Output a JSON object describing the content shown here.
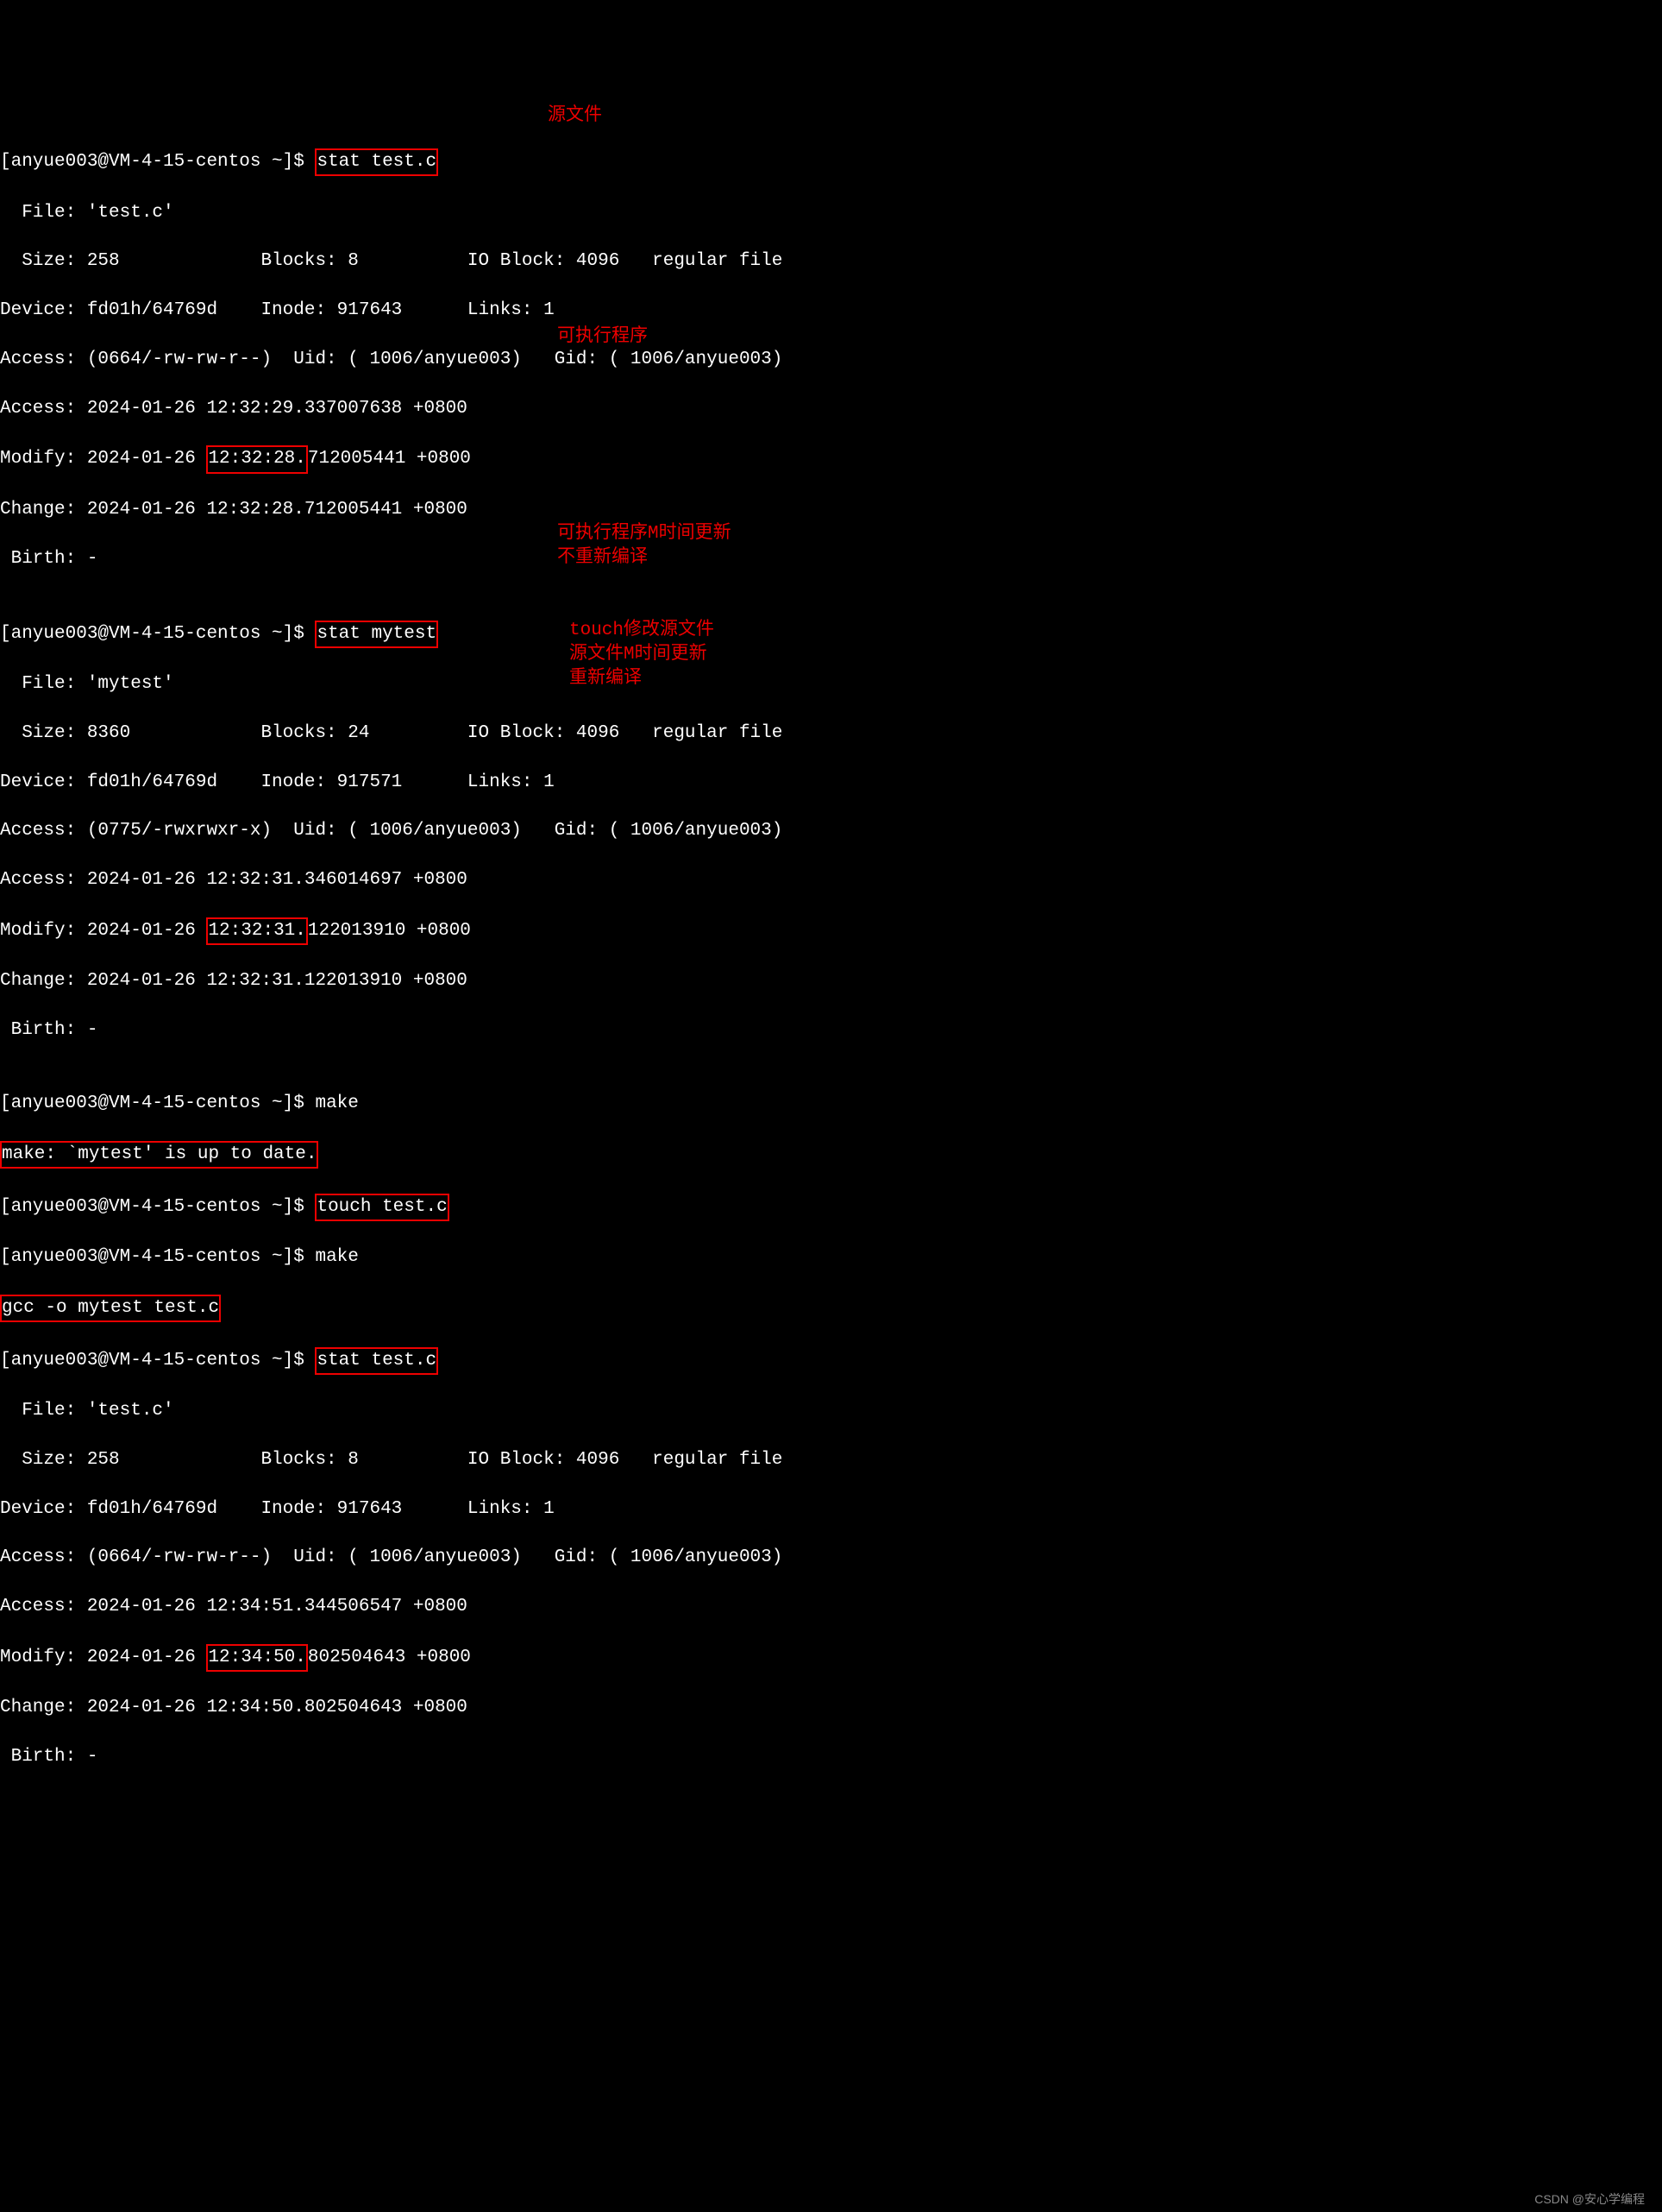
{
  "prompt": "[anyue003@VM-4-15-centos ~]$ ",
  "cmd1": "stat test.c",
  "stat1": {
    "file": "  File: 'test.c'",
    "size": "  Size: 258             Blocks: 8          IO Block: 4096   regular file",
    "device": "Device: fd01h/64769d    Inode: 917643      Links: 1",
    "access_perm": "Access: (0664/-rw-rw-r--)  Uid: ( 1006/anyue003)   Gid: ( 1006/anyue003)",
    "atime": "Access: 2024-01-26 12:32:29.337007638 +0800",
    "mtime_pre": "Modify: 2024-01-26 ",
    "mtime_box": "12:32:28.",
    "mtime_post": "712005441 +0800",
    "ctime": "Change: 2024-01-26 12:32:28.712005441 +0800",
    "birth": " Birth: -"
  },
  "cmd2": "stat mytest",
  "stat2": {
    "file": "  File: 'mytest'",
    "size": "  Size: 8360            Blocks: 24         IO Block: 4096   regular file",
    "device": "Device: fd01h/64769d    Inode: 917571      Links: 1",
    "access_perm": "Access: (0775/-rwxrwxr-x)  Uid: ( 1006/anyue003)   Gid: ( 1006/anyue003)",
    "atime": "Access: 2024-01-26 12:32:31.346014697 +0800",
    "mtime_pre": "Modify: 2024-01-26 ",
    "mtime_box": "12:32:31.",
    "mtime_post": "122013910 +0800",
    "ctime": "Change: 2024-01-26 12:32:31.122013910 +0800",
    "birth": " Birth: -"
  },
  "cmd3": "make",
  "make_uptodate": "make: `mytest' is up to date.",
  "cmd4": "touch test.c",
  "cmd5": "make",
  "gcc_line": "gcc -o mytest test.c",
  "cmd6": "stat test.c",
  "stat3": {
    "file": "  File: 'test.c'",
    "size": "  Size: 258             Blocks: 8          IO Block: 4096   regular file",
    "device": "Device: fd01h/64769d    Inode: 917643      Links: 1",
    "access_perm": "Access: (0664/-rw-rw-r--)  Uid: ( 1006/anyue003)   Gid: ( 1006/anyue003)",
    "atime": "Access: 2024-01-26 12:34:51.344506547 +0800",
    "mtime_pre": "Modify: 2024-01-26 ",
    "mtime_box": "12:34:50.",
    "mtime_post": "802504643 +0800",
    "ctime": "Change: 2024-01-26 12:34:50.802504643 +0800",
    "birth": " Birth: -"
  },
  "anno": {
    "a1": "源文件",
    "a2": "可执行程序",
    "a3_l1": "可执行程序M时间更新",
    "a3_l2": "不重新编译",
    "a4_l1": "touch修改源文件",
    "a4_l2": "源文件M时间更新",
    "a4_l3": "重新编译"
  },
  "watermark": "CSDN @安心学编程"
}
